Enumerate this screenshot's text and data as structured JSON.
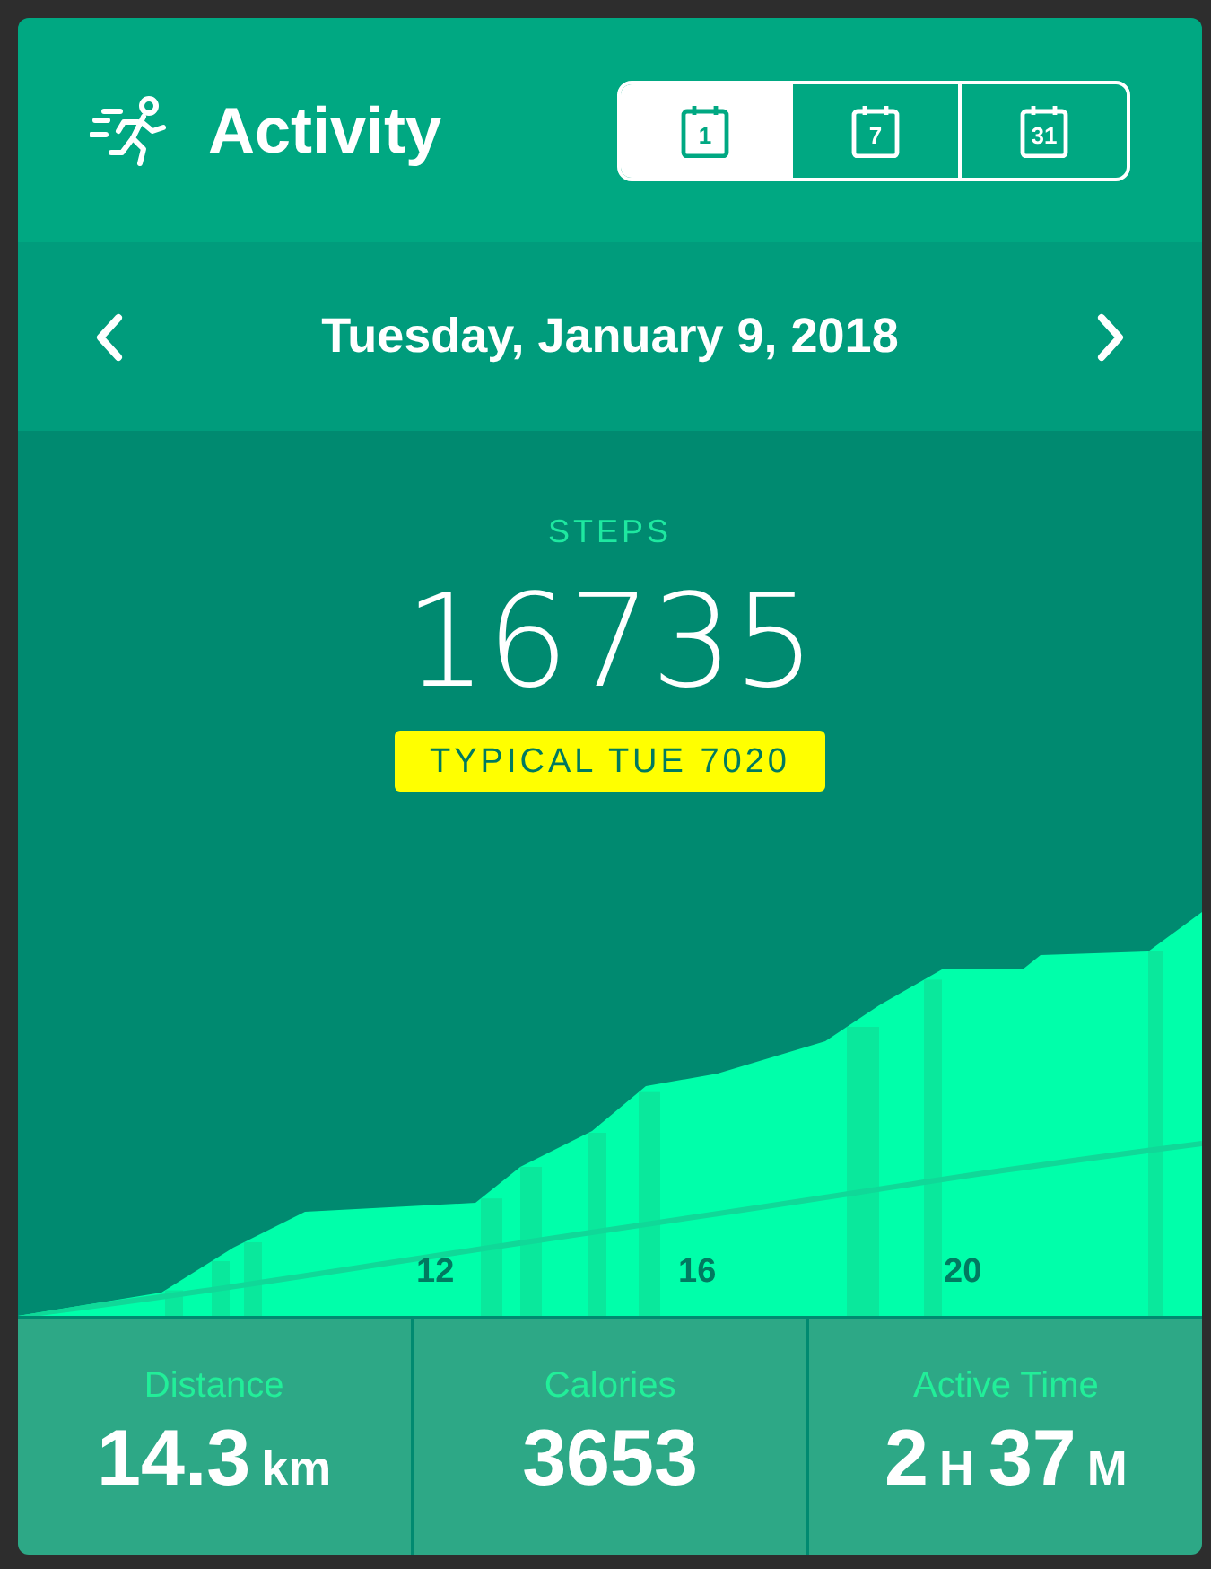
{
  "header": {
    "title": "Activity"
  },
  "period_tabs": [
    {
      "label": "1",
      "selected": true
    },
    {
      "label": "7",
      "selected": false
    },
    {
      "label": "31",
      "selected": false
    }
  ],
  "date_bar": {
    "date": "Tuesday, January 9, 2018"
  },
  "steps": {
    "label": "STEPS",
    "value": "16735",
    "typical": "TYPICAL TUE 7020"
  },
  "chart": {
    "x_labels": [
      "12",
      "16",
      "20"
    ]
  },
  "stats": [
    {
      "label": "Distance",
      "parts": [
        {
          "kind": "number",
          "text": "14.3"
        },
        {
          "kind": "unit",
          "text": "km"
        }
      ]
    },
    {
      "label": "Calories",
      "parts": [
        {
          "kind": "number",
          "text": "3653"
        }
      ]
    },
    {
      "label": "Active Time",
      "parts": [
        {
          "kind": "number",
          "text": "2"
        },
        {
          "kind": "unit",
          "text": "H"
        },
        {
          "kind": "number",
          "text": "37"
        },
        {
          "kind": "unit",
          "text": "M"
        }
      ]
    }
  ]
}
